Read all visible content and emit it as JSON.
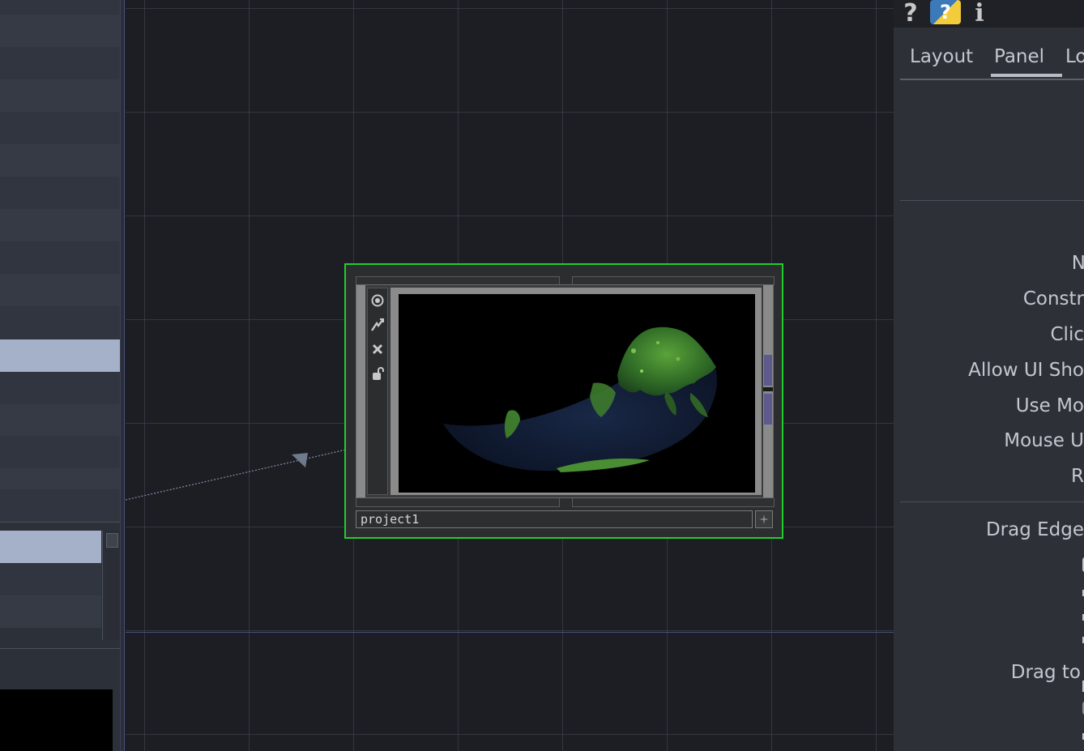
{
  "network": {
    "node": {
      "name": "project1"
    }
  },
  "params_panel": {
    "topbar": {
      "help_icon": "question-mark",
      "python_help_icon": "?",
      "info_icon": "i",
      "help_glyph": "?",
      "info_glyph": "i"
    },
    "tabs": [
      {
        "label": "Layout"
      },
      {
        "label": "Panel"
      },
      {
        "label": "Lo"
      }
    ],
    "active_tab": "Panel",
    "params": [
      {
        "label": "N"
      },
      {
        "label": "Constr"
      },
      {
        "label": "Clic"
      },
      {
        "label": "Allow UI Sho"
      },
      {
        "label": "Use Mo"
      },
      {
        "label": "Mouse U"
      },
      {
        "label": "R"
      },
      {
        "label": "Drag Edge"
      },
      {
        "label": "Drag to"
      }
    ]
  },
  "colors": {
    "selection": "#1fce2c",
    "background": "#1c1e24",
    "left_selected_row": "#a5b1c8"
  }
}
